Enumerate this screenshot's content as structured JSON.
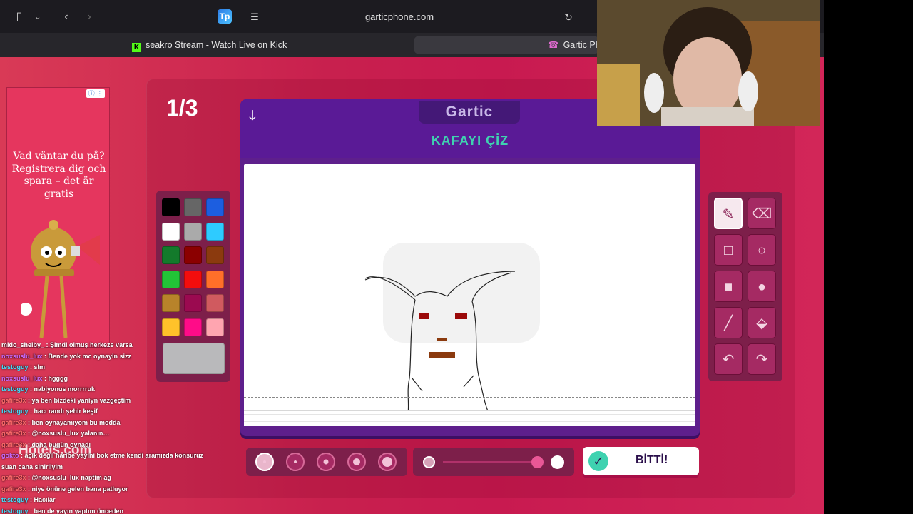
{
  "browser": {
    "url": "garticphone.com",
    "tabs": [
      {
        "label": "seakro Stream - Watch Live on Kick",
        "favicon": "kick-icon"
      },
      {
        "label": "Gartic Phone",
        "favicon": "phone-icon"
      }
    ]
  },
  "game": {
    "round": "1/3",
    "logo": "Gartic",
    "prompt": "KAFAYI ÇİZ",
    "done_label": "BİTTİ!",
    "palette": [
      "#000000",
      "#666666",
      "#1c5ee0",
      "#ffffff",
      "#aaaaaa",
      "#2ecbff",
      "#137a2b",
      "#8b0000",
      "#8b3a0e",
      "#22c437",
      "#f30d0d",
      "#ff6f29",
      "#b8832a",
      "#9b0a50",
      "#d05a5f",
      "#ffc22a",
      "#ff0c88",
      "#ffa5b0"
    ],
    "selected_color": "#b9b9bb",
    "tools": [
      {
        "name": "pencil-tool",
        "icon": "✎",
        "active": true
      },
      {
        "name": "eraser-tool",
        "icon": "⌫",
        "active": false
      },
      {
        "name": "rect-outline-tool",
        "icon": "□",
        "active": false
      },
      {
        "name": "circle-outline-tool",
        "icon": "○",
        "active": false
      },
      {
        "name": "rect-fill-tool",
        "icon": "■",
        "active": false
      },
      {
        "name": "circle-fill-tool",
        "icon": "●",
        "active": false
      },
      {
        "name": "line-tool",
        "icon": "╱",
        "active": false
      },
      {
        "name": "bucket-tool",
        "icon": "⬙",
        "active": false
      },
      {
        "name": "undo-tool",
        "icon": "↶",
        "active": false
      },
      {
        "name": "redo-tool",
        "icon": "↷",
        "active": false
      }
    ],
    "brush_sizes_selected": 0
  },
  "ad": {
    "text": "Vad väntar du på? Registrera dig och spara – det är gratis",
    "brand": "Hotels.com"
  },
  "chat": [
    {
      "user": "mido_shelby_",
      "msg": "Şimdi olmuş herkeze varsa",
      "color": "#fff"
    },
    {
      "user": "noxsuslu_lux",
      "msg": "Bende yok mc oynayin sizz",
      "color": "#c86bff"
    },
    {
      "user": "testoguy",
      "msg": "slm",
      "color": "#40e0ff"
    },
    {
      "user": "noxsuslu_lux",
      "msg": "hgggg",
      "color": "#c86bff"
    },
    {
      "user": "testoguy",
      "msg": "nabiyonus morrrruk",
      "color": "#40e0ff"
    },
    {
      "user": "gafire3x",
      "msg": "ya ben bizdeki yaniyn vazgeçtim",
      "color": "#ff6b6b"
    },
    {
      "user": "testoguy",
      "msg": "hacı randı şehir keşif",
      "color": "#40e0ff"
    },
    {
      "user": "gafire3x",
      "msg": "ben oynayamıyom bu modda",
      "color": "#ff6b6b"
    },
    {
      "user": "gafire3x",
      "msg": "@noxsuslu_lux yalanın…",
      "color": "#ff6b6b"
    },
    {
      "user": "gafire3x",
      "msg": "daha bugün oynadı",
      "color": "#ff6b6b"
    },
    {
      "user": "gokto",
      "msg": "açık değil haribe yayini bok etme kendi aramızda konsuruz",
      "color": "#c86bff"
    },
    {
      "user": "",
      "msg": "suan cana sinirliyim",
      "color": "#fff"
    },
    {
      "user": "gafire3x",
      "msg": "@noxsuslu_lux naptim ag",
      "color": "#ff6b6b"
    },
    {
      "user": "gafire3x",
      "msg": "niye önüne gelen bana patluyor",
      "color": "#ff6b6b"
    },
    {
      "user": "testoguy",
      "msg": "Hacılar",
      "color": "#40e0ff"
    },
    {
      "user": "testoguy",
      "msg": "ben de yayın yaptım önceden",
      "color": "#40e0ff"
    }
  ]
}
